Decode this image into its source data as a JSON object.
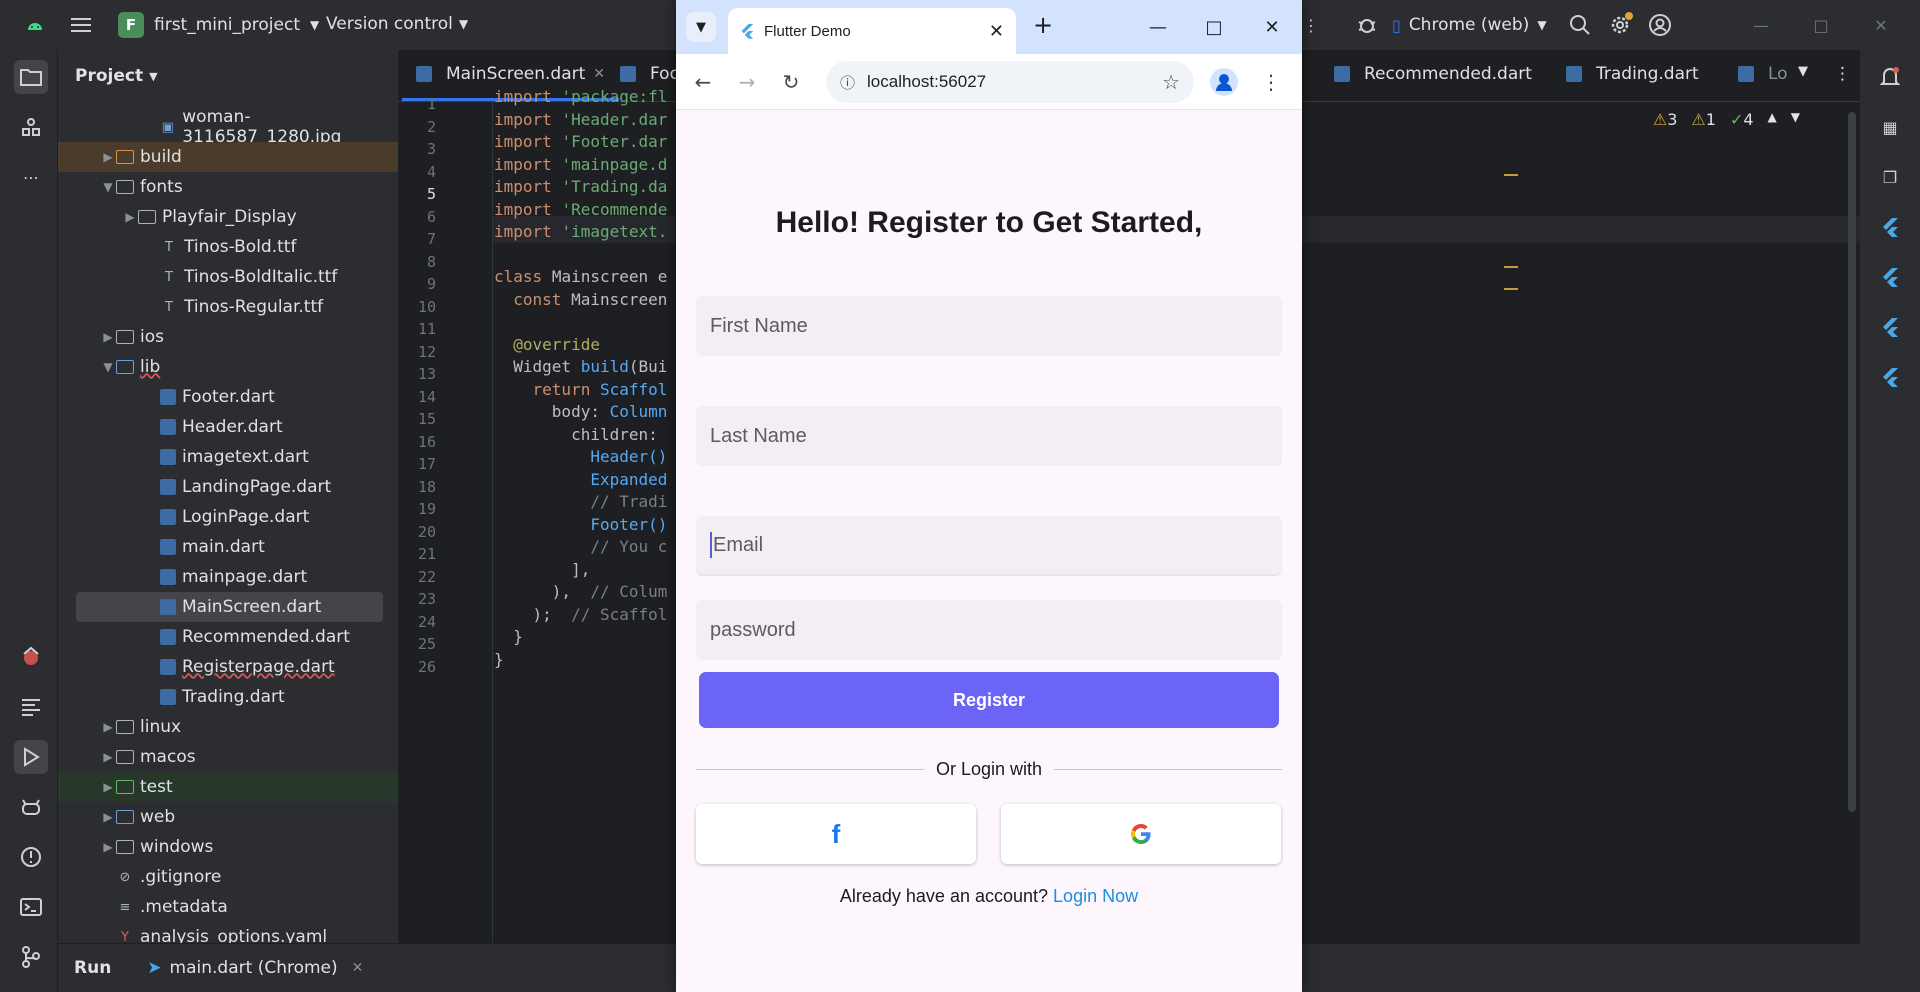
{
  "ide": {
    "project_badge": "F",
    "project_name": "first_mini_project",
    "vcs_label": "Version control",
    "device": "Chrome (web)",
    "panel_title": "Project",
    "tree": [
      {
        "label": "woman-3116587_1280.jpg",
        "kind": "image",
        "indent": 3
      },
      {
        "label": "build",
        "kind": "folder-collapsed",
        "indent": 1
      },
      {
        "label": "fonts",
        "kind": "folder-open",
        "indent": 1
      },
      {
        "label": "Playfair_Display",
        "kind": "folder-collapsed",
        "indent": 2
      },
      {
        "label": "Tinos-Bold.ttf",
        "kind": "font",
        "indent": 3
      },
      {
        "label": "Tinos-BoldItalic.ttf",
        "kind": "font",
        "indent": 3
      },
      {
        "label": "Tinos-Regular.ttf",
        "kind": "font",
        "indent": 3
      },
      {
        "label": "ios",
        "kind": "folder-collapsed",
        "indent": 1
      },
      {
        "label": "lib",
        "kind": "folder-open",
        "indent": 1
      },
      {
        "label": "Footer.dart",
        "kind": "dart",
        "indent": 3
      },
      {
        "label": "Header.dart",
        "kind": "dart",
        "indent": 3
      },
      {
        "label": "imagetext.dart",
        "kind": "dart",
        "indent": 3
      },
      {
        "label": "LandingPage.dart",
        "kind": "dart",
        "indent": 3
      },
      {
        "label": "LoginPage.dart",
        "kind": "dart",
        "indent": 3
      },
      {
        "label": "main.dart",
        "kind": "dart",
        "indent": 3
      },
      {
        "label": "mainpage.dart",
        "kind": "dart",
        "indent": 3
      },
      {
        "label": "MainScreen.dart",
        "kind": "dart",
        "indent": 3
      },
      {
        "label": "Recommended.dart",
        "kind": "dart",
        "indent": 3
      },
      {
        "label": "Registerpage.dart",
        "kind": "dart",
        "indent": 3
      },
      {
        "label": "Trading.dart",
        "kind": "dart",
        "indent": 3
      },
      {
        "label": "linux",
        "kind": "folder-collapsed",
        "indent": 1
      },
      {
        "label": "macos",
        "kind": "folder-collapsed",
        "indent": 1
      },
      {
        "label": "test",
        "kind": "folder-collapsed",
        "indent": 1
      },
      {
        "label": "web",
        "kind": "folder-collapsed",
        "indent": 1
      },
      {
        "label": "windows",
        "kind": "folder-collapsed",
        "indent": 1
      },
      {
        "label": ".gitignore",
        "kind": "ignore",
        "indent": 1
      },
      {
        "label": ".metadata",
        "kind": "text",
        "indent": 1
      },
      {
        "label": "analysis_options.yaml",
        "kind": "yaml",
        "indent": 1
      }
    ],
    "tabs": [
      {
        "label": "MainScreen.dart",
        "active": true
      },
      {
        "label": "Foo",
        "active": false
      },
      {
        "label": "Recommended.dart",
        "active": false
      },
      {
        "label": "Trading.dart",
        "active": false
      },
      {
        "label": "Lo",
        "active": false
      }
    ],
    "inspections": {
      "warnings": "3",
      "weak_warnings": "1",
      "ok": "4"
    },
    "line_numbers": [
      "1",
      "2",
      "3",
      "4",
      "5",
      "6",
      "7",
      "8",
      "9",
      "10",
      "11",
      "12",
      "13",
      "14",
      "15",
      "16",
      "17",
      "18",
      "19",
      "20",
      "21",
      "22",
      "23",
      "24",
      "25",
      "26"
    ],
    "code_lines": [
      "import 'package:fl",
      "import 'Header.dar",
      "import 'Footer.dar",
      "import 'mainpage.d",
      "import 'Trading.da",
      "import 'Recommende",
      "import 'imagetext.",
      "",
      "class Mainscreen e",
      "  const Mainscreen",
      "",
      "  @override",
      "  Widget build(Bui",
      "    return Scaffol",
      "      body: Column",
      "        children:",
      "          Header()",
      "          Expanded",
      "          // Tradi",
      "          Footer()",
      "          // You c",
      "        ],",
      "      ),  // Colum",
      "    );  // Scaffol",
      "  }",
      "}"
    ],
    "bottom": {
      "run_label": "Run",
      "run_config": "main.dart (Chrome)"
    }
  },
  "browser": {
    "tab_title": "Flutter Demo",
    "url": "localhost:56027"
  },
  "app": {
    "title": "Hello! Register to Get Started,",
    "first_name_placeholder": "First Name",
    "last_name_placeholder": "Last Name",
    "email_placeholder": "Email",
    "password_placeholder": "password",
    "register_label": "Register",
    "divider_text": "Or Login with",
    "facebook_glyph": "f",
    "login_prompt": "Already have an account?",
    "login_link": "Login Now"
  },
  "colors": {
    "register_button": "#6c63f7",
    "login_link": "#1a8fe0",
    "ide_background": "#1e1f22"
  }
}
